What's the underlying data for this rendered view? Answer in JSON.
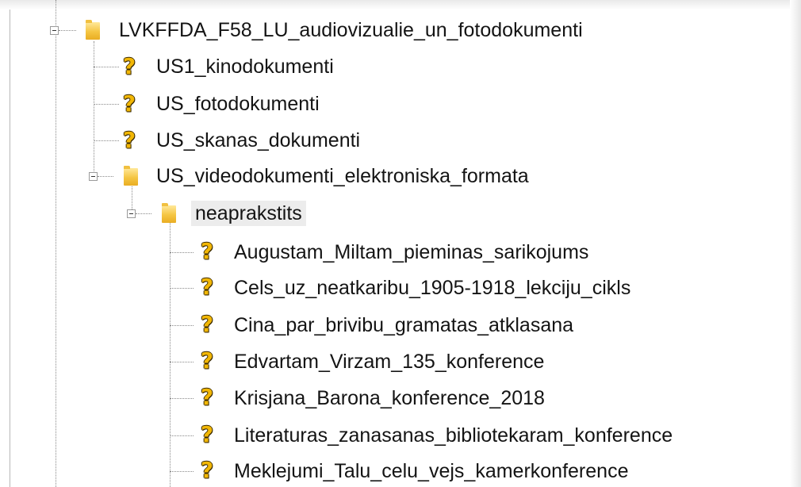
{
  "tree": {
    "root": {
      "label": "LVKFFDA_F58_LU_audiovizualie_un_fotodokumenti",
      "expanded": true,
      "icon": "folder-icon"
    },
    "children": [
      {
        "label": "US1_kinodokumenti",
        "icon": "unknown-question-icon"
      },
      {
        "label": "US_fotodokumenti",
        "icon": "unknown-question-icon"
      },
      {
        "label": "US_skanas_dokumenti",
        "icon": "unknown-question-icon"
      },
      {
        "label": "US_videodokumenti_elektroniska_formata",
        "icon": "folder-icon",
        "expanded": true
      }
    ],
    "subfolder": {
      "label": "neaprakstits",
      "icon": "folder-icon",
      "expanded": true,
      "selected": true
    },
    "items": [
      {
        "label": "Augustam_Miltam_pieminas_sarikojums",
        "icon": "unknown-question-icon"
      },
      {
        "label": "Cels_uz_neatkaribu_1905-1918_lekciju_cikls",
        "icon": "unknown-question-icon"
      },
      {
        "label": "Cina_par_brivibu_gramatas_atklasana",
        "icon": "unknown-question-icon"
      },
      {
        "label": "Edvartam_Virzam_135_konference",
        "icon": "unknown-question-icon"
      },
      {
        "label": "Krisjana_Barona_konference_2018",
        "icon": "unknown-question-icon"
      },
      {
        "label": "Literaturas_zanasanas_bibliotekaram_konference",
        "icon": "unknown-question-icon"
      },
      {
        "label": "Meklejumi_Talu_celu_vejs_kamerkonference",
        "icon": "unknown-question-icon"
      }
    ]
  },
  "colors": {
    "folder": "#f5c542",
    "question_mark": "#f2b705",
    "text": "#141414",
    "selection": "#ececec"
  }
}
